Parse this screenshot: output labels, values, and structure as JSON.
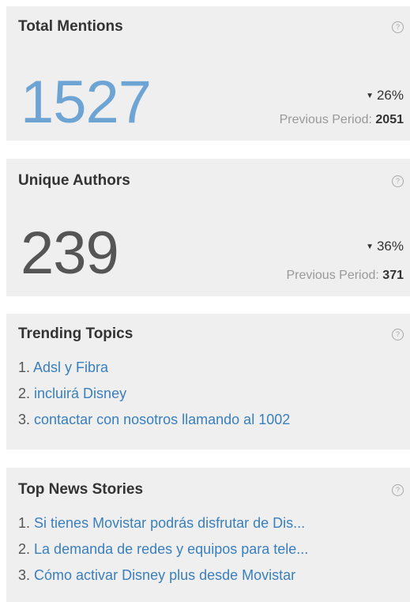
{
  "metrics": [
    {
      "title": "Total Mentions",
      "value": "1527",
      "value_color": "#6ea4d4",
      "change": "26%",
      "change_direction": "down",
      "previous_label": "Previous Period:",
      "previous_value": "2051"
    },
    {
      "title": "Unique Authors",
      "value": "239",
      "value_color": "#555555",
      "change": "36%",
      "change_direction": "down",
      "previous_label": "Previous Period:",
      "previous_value": "371"
    }
  ],
  "trending": {
    "title": "Trending Topics",
    "items": [
      {
        "num": "1.",
        "text": "Adsl y Fibra"
      },
      {
        "num": "2.",
        "text": "incluirá Disney"
      },
      {
        "num": "3.",
        "text": "contactar con nosotros llamando al 1002"
      }
    ]
  },
  "news": {
    "title": "Top News Stories",
    "items": [
      {
        "num": "1.",
        "text": "Si tienes Movistar podrás disfrutar de Dis..."
      },
      {
        "num": "2.",
        "text": "La demanda de redes y equipos para tele..."
      },
      {
        "num": "3.",
        "text": "Cómo activar Disney plus desde Movistar"
      }
    ]
  },
  "icons": {
    "help": "help-circle-icon",
    "down": "caret-down-icon"
  },
  "colors": {
    "link": "#3a7fbd",
    "card_bg": "#efefef"
  }
}
